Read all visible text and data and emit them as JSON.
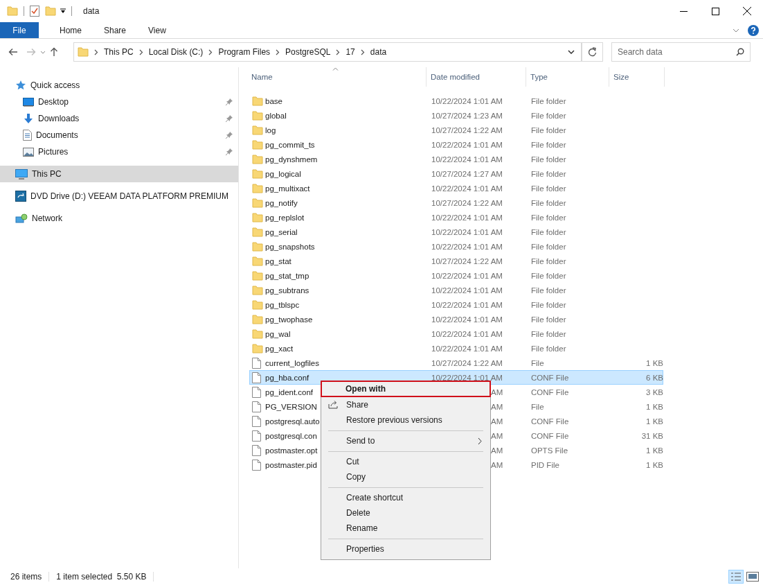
{
  "window": {
    "title": "data"
  },
  "ribbon": {
    "tabs": [
      {
        "label": "File",
        "selected": true
      },
      {
        "label": "Home",
        "selected": false
      },
      {
        "label": "Share",
        "selected": false
      },
      {
        "label": "View",
        "selected": false
      }
    ]
  },
  "address": {
    "path": [
      "This PC",
      "Local Disk (C:)",
      "Program Files",
      "PostgreSQL",
      "17",
      "data"
    ],
    "search": {
      "placeholder": "Search data"
    }
  },
  "sidebar": {
    "items": [
      {
        "label": "Quick access",
        "kind": "star",
        "selected": false,
        "children": [
          {
            "label": "Desktop",
            "kind": "desktop",
            "pinned": true,
            "selected": false
          },
          {
            "label": "Downloads",
            "kind": "download",
            "pinned": true,
            "selected": false
          },
          {
            "label": "Documents",
            "kind": "document",
            "pinned": true,
            "selected": false
          },
          {
            "label": "Pictures",
            "kind": "picture",
            "pinned": true,
            "selected": false
          }
        ]
      },
      {
        "label": "This PC",
        "kind": "pc",
        "selected": true
      },
      {
        "label": "DVD Drive (D:) VEEAM DATA PLATFORM PREMIUM",
        "kind": "dvd",
        "selected": false
      },
      {
        "label": "Network",
        "kind": "network",
        "selected": false
      }
    ]
  },
  "file_list": {
    "columns": [
      "Name",
      "Date modified",
      "Type",
      "Size"
    ],
    "rows": [
      {
        "kind": "folder",
        "name": "base",
        "date": "10/22/2024 1:01 AM",
        "date_partial": false,
        "type": "File folder",
        "size": "",
        "selected": false
      },
      {
        "kind": "folder",
        "name": "global",
        "date": "10/27/2024 1:23 AM",
        "date_partial": false,
        "type": "File folder",
        "size": "",
        "selected": false
      },
      {
        "kind": "folder",
        "name": "log",
        "date": "10/27/2024 1:22 AM",
        "date_partial": false,
        "type": "File folder",
        "size": "",
        "selected": false
      },
      {
        "kind": "folder",
        "name": "pg_commit_ts",
        "date": "10/22/2024 1:01 AM",
        "date_partial": false,
        "type": "File folder",
        "size": "",
        "selected": false
      },
      {
        "kind": "folder",
        "name": "pg_dynshmem",
        "date": "10/22/2024 1:01 AM",
        "date_partial": false,
        "type": "File folder",
        "size": "",
        "selected": false
      },
      {
        "kind": "folder",
        "name": "pg_logical",
        "date": "10/27/2024 1:27 AM",
        "date_partial": false,
        "type": "File folder",
        "size": "",
        "selected": false
      },
      {
        "kind": "folder",
        "name": "pg_multixact",
        "date": "10/22/2024 1:01 AM",
        "date_partial": false,
        "type": "File folder",
        "size": "",
        "selected": false
      },
      {
        "kind": "folder",
        "name": "pg_notify",
        "date": "10/27/2024 1:22 AM",
        "date_partial": false,
        "type": "File folder",
        "size": "",
        "selected": false
      },
      {
        "kind": "folder",
        "name": "pg_replslot",
        "date": "10/22/2024 1:01 AM",
        "date_partial": false,
        "type": "File folder",
        "size": "",
        "selected": false
      },
      {
        "kind": "folder",
        "name": "pg_serial",
        "date": "10/22/2024 1:01 AM",
        "date_partial": false,
        "type": "File folder",
        "size": "",
        "selected": false
      },
      {
        "kind": "folder",
        "name": "pg_snapshots",
        "date": "10/22/2024 1:01 AM",
        "date_partial": false,
        "type": "File folder",
        "size": "",
        "selected": false
      },
      {
        "kind": "folder",
        "name": "pg_stat",
        "date": "10/27/2024 1:22 AM",
        "date_partial": false,
        "type": "File folder",
        "size": "",
        "selected": false
      },
      {
        "kind": "folder",
        "name": "pg_stat_tmp",
        "date": "10/22/2024 1:01 AM",
        "date_partial": false,
        "type": "File folder",
        "size": "",
        "selected": false
      },
      {
        "kind": "folder",
        "name": "pg_subtrans",
        "date": "10/22/2024 1:01 AM",
        "date_partial": false,
        "type": "File folder",
        "size": "",
        "selected": false
      },
      {
        "kind": "folder",
        "name": "pg_tblspc",
        "date": "10/22/2024 1:01 AM",
        "date_partial": false,
        "type": "File folder",
        "size": "",
        "selected": false
      },
      {
        "kind": "folder",
        "name": "pg_twophase",
        "date": "10/22/2024 1:01 AM",
        "date_partial": false,
        "type": "File folder",
        "size": "",
        "selected": false
      },
      {
        "kind": "folder",
        "name": "pg_wal",
        "date": "10/22/2024 1:01 AM",
        "date_partial": false,
        "type": "File folder",
        "size": "",
        "selected": false
      },
      {
        "kind": "folder",
        "name": "pg_xact",
        "date": "10/22/2024 1:01 AM",
        "date_partial": false,
        "type": "File folder",
        "size": "",
        "selected": false
      },
      {
        "kind": "file",
        "name": "current_logfiles",
        "date": "10/27/2024 1:22 AM",
        "date_partial": false,
        "type": "File",
        "size": "1 KB",
        "selected": false
      },
      {
        "kind": "file",
        "name": "pg_hba.conf",
        "date": "10/22/2024 1:01 AM",
        "date_partial": false,
        "type": "CONF File",
        "size": "6 KB",
        "selected": true
      },
      {
        "kind": "file",
        "name": "pg_ident.conf",
        "date": "AM",
        "date_partial": true,
        "type": "CONF File",
        "size": "3 KB",
        "selected": false
      },
      {
        "kind": "file",
        "name": "PG_VERSION",
        "date": "AM",
        "date_partial": true,
        "type": "File",
        "size": "1 KB",
        "selected": false
      },
      {
        "kind": "file",
        "name": "postgresql.auto",
        "date": "AM",
        "date_partial": true,
        "type": "CONF File",
        "size": "1 KB",
        "selected": false
      },
      {
        "kind": "file",
        "name": "postgresql.con",
        "date": "AM",
        "date_partial": true,
        "type": "CONF File",
        "size": "31 KB",
        "selected": false
      },
      {
        "kind": "file",
        "name": "postmaster.opt",
        "date": "AM",
        "date_partial": true,
        "type": "OPTS File",
        "size": "1 KB",
        "selected": false
      },
      {
        "kind": "file",
        "name": "postmaster.pid",
        "date": "AM",
        "date_partial": true,
        "type": "PID File",
        "size": "1 KB",
        "selected": false
      }
    ]
  },
  "context_menu": {
    "items": [
      {
        "kind": "item",
        "label": "Open with",
        "default": true,
        "highlighted": true
      },
      {
        "kind": "share",
        "label": "Share",
        "default": false,
        "highlighted": false
      },
      {
        "kind": "item",
        "label": "Restore previous versions",
        "default": false,
        "highlighted": false
      },
      {
        "kind": "separator"
      },
      {
        "kind": "submenu",
        "label": "Send to",
        "default": false,
        "highlighted": false
      },
      {
        "kind": "separator"
      },
      {
        "kind": "item",
        "label": "Cut",
        "default": false,
        "highlighted": false
      },
      {
        "kind": "item",
        "label": "Copy",
        "default": false,
        "highlighted": false
      },
      {
        "kind": "separator"
      },
      {
        "kind": "item",
        "label": "Create shortcut",
        "default": false,
        "highlighted": false
      },
      {
        "kind": "item",
        "label": "Delete",
        "default": false,
        "highlighted": false
      },
      {
        "kind": "item",
        "label": "Rename",
        "default": false,
        "highlighted": false
      },
      {
        "kind": "separator"
      },
      {
        "kind": "item",
        "label": "Properties",
        "default": false,
        "highlighted": false
      }
    ]
  },
  "status_bar": {
    "item_count": "26 items",
    "selection": "1 item selected  5.50 KB"
  }
}
